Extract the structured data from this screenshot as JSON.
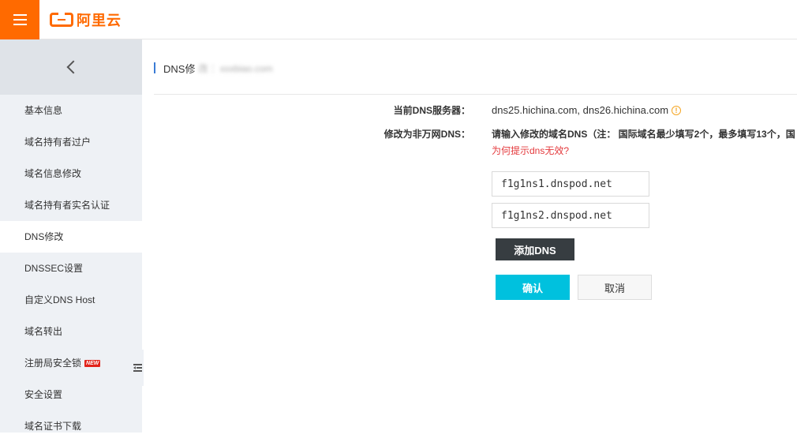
{
  "header": {
    "brand": "阿里云",
    "accent_color": "#ff6a00",
    "menu_icon": "hamburger-icon"
  },
  "sidebar": {
    "back_icon": "chevron-left-icon",
    "items": [
      {
        "label": "基本信息"
      },
      {
        "label": "域名持有者过户"
      },
      {
        "label": "域名信息修改"
      },
      {
        "label": "域名持有者实名认证"
      },
      {
        "label": "DNS修改",
        "active": true
      },
      {
        "label": "DNSSEC设置"
      },
      {
        "label": "自定义DNS Host"
      },
      {
        "label": "域名转出"
      },
      {
        "label": "注册局安全锁",
        "badge": "NEW"
      },
      {
        "label": "安全设置"
      },
      {
        "label": "域名证书下载"
      }
    ]
  },
  "main": {
    "title": "DNS修",
    "title_blurred": "改 ：xxxbiao.com",
    "current_dns_label": "当前DNS服务器：",
    "current_dns_value": "dns25.hichina.com, dns26.hichina.com",
    "modify_label": "修改为非万网DNS：",
    "hint": "请输入修改的域名DNS（注： 国际域名最少填写2个，最多填写13个，国",
    "warn_link": "为何提示dns无效?",
    "dns_inputs": [
      "f1g1ns1.dnspod.net",
      "f1g1ns2.dnspod.net"
    ],
    "add_dns_button": "添加DNS",
    "confirm_button": "确认",
    "cancel_button": "取消"
  }
}
